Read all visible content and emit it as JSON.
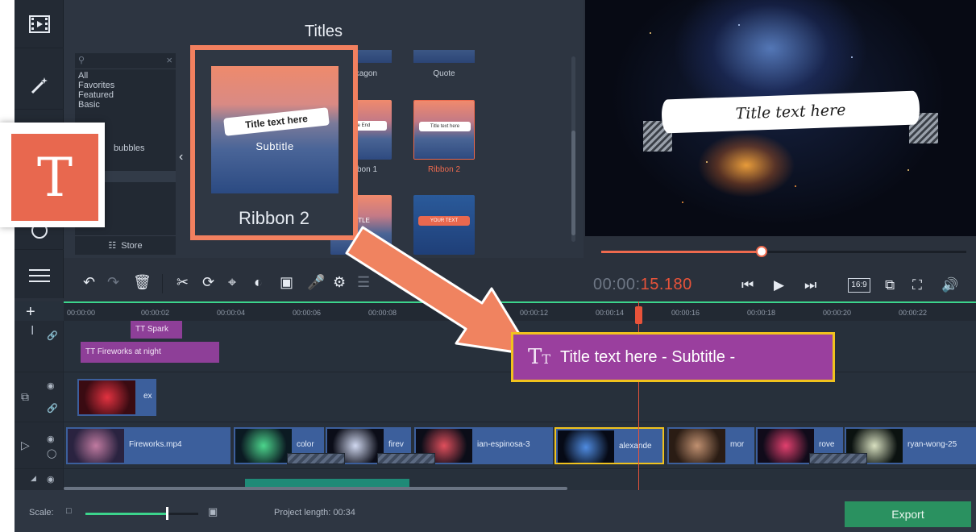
{
  "titles_panel": {
    "header": "Titles",
    "categories": [
      "All",
      "Favorites",
      "Featured",
      "Basic",
      "bubbles"
    ],
    "store_label": "Store",
    "tiles": [
      {
        "label": "Hexagon"
      },
      {
        "label": "Quote"
      },
      {
        "label": "Ribbon 1",
        "preview_text": "The End"
      },
      {
        "label": "Ribbon 2",
        "preview_text": "Title text here",
        "selected": true
      },
      {
        "label": "",
        "preview_text": "TITLE"
      },
      {
        "label": "",
        "preview_text": "YOUR TEXT"
      }
    ]
  },
  "callout": {
    "tile_label": "Ribbon 2",
    "tile_title": "Title text here",
    "tile_subtitle": "Subtitle",
    "clip_text": "Title text here - Subtitle -",
    "icon_glyph": "T"
  },
  "preview": {
    "title_text": "Title text here",
    "progress_fraction": 0.44
  },
  "playback": {
    "timecode_prefix": "00:00:",
    "timecode_highlight": "15.180",
    "aspect_ratio": "16:9"
  },
  "ruler": {
    "ticks": [
      "00:00:00",
      "00:00:02",
      "00:00:04",
      "00:00:06",
      "00:00:08",
      "00:00:12",
      "00:00:14",
      "00:00:16",
      "00:00:18",
      "00:00:20",
      "00:00:22"
    ]
  },
  "timeline": {
    "title_clips": [
      "Spark",
      "Fireworks at night"
    ],
    "overlay_clip": "ex",
    "video_clips": [
      "Fireworks.mp4",
      "color",
      "firev",
      "ian-espinosa-3",
      "alexande",
      "mor",
      "rove",
      "ryan-wong-25"
    ]
  },
  "bottom": {
    "scale_label": "Scale:",
    "project_length": "Project length:  00:34",
    "export_label": "Export"
  },
  "colors": {
    "accent": "#ee6a4e",
    "title_clip": "#8e3f98",
    "video_clip": "#3c5f9c",
    "export": "#2a9160",
    "timeline_marker": "#3cd48c"
  }
}
